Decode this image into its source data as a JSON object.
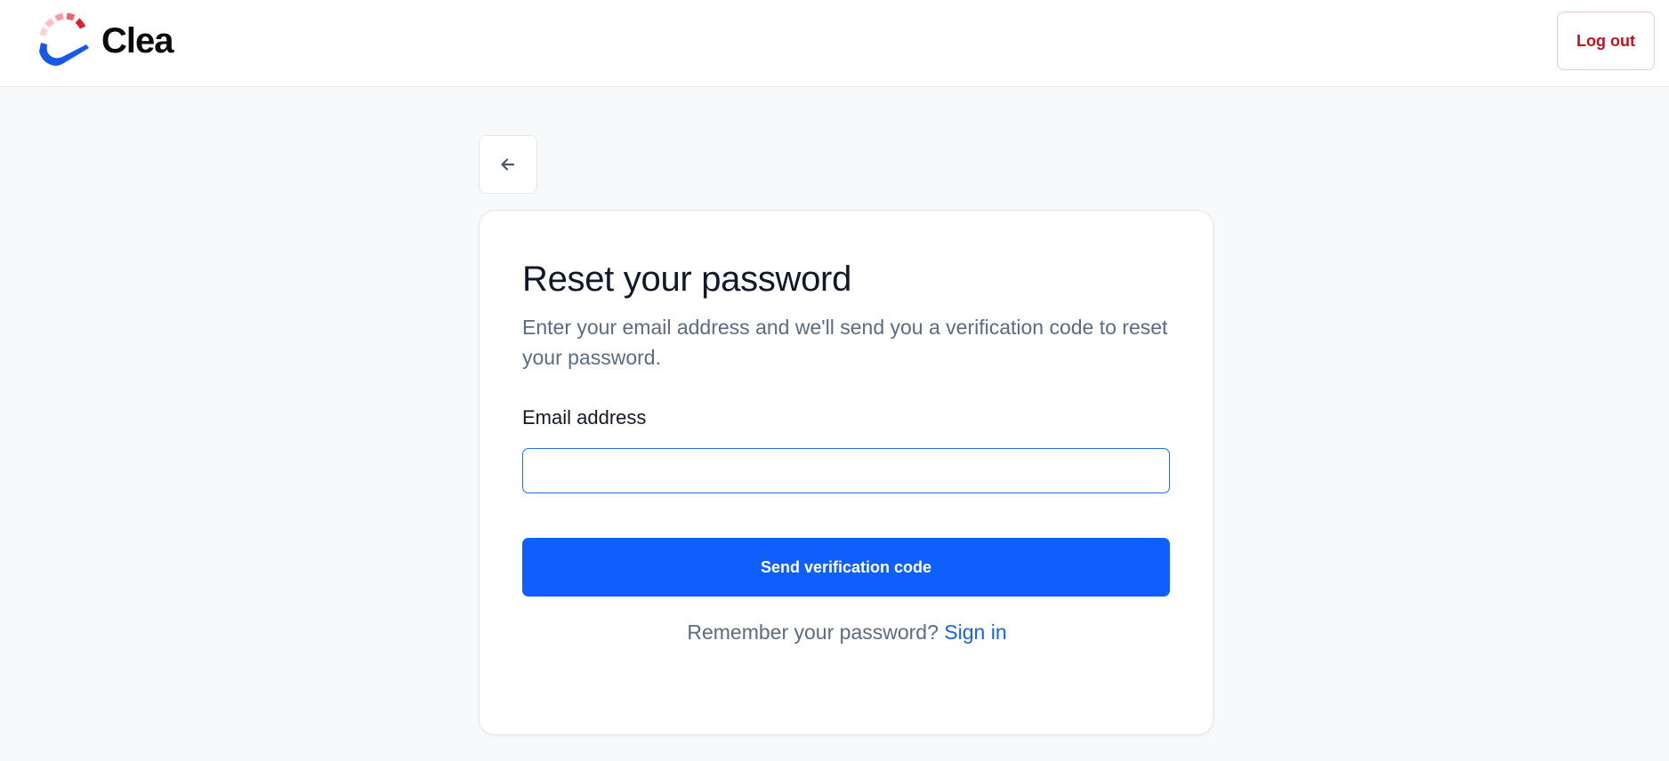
{
  "header": {
    "brand_name": "Clea",
    "logout_label": "Log out"
  },
  "nav": {
    "back_icon": "arrow-left-icon"
  },
  "reset_card": {
    "title": "Reset your password",
    "subtitle": "Enter your email address and we'll send you a verification code to reset your password.",
    "email_label": "Email address",
    "email_value": "",
    "submit_label": "Send verification code",
    "remember_text": "Remember your password?",
    "signin_label": "Sign in"
  },
  "colors": {
    "primary": "#0f5ffd",
    "logout_text": "#c0121e",
    "link": "#1565e0",
    "page_bg": "#f8f9fb",
    "muted_text": "#5b6b82"
  }
}
